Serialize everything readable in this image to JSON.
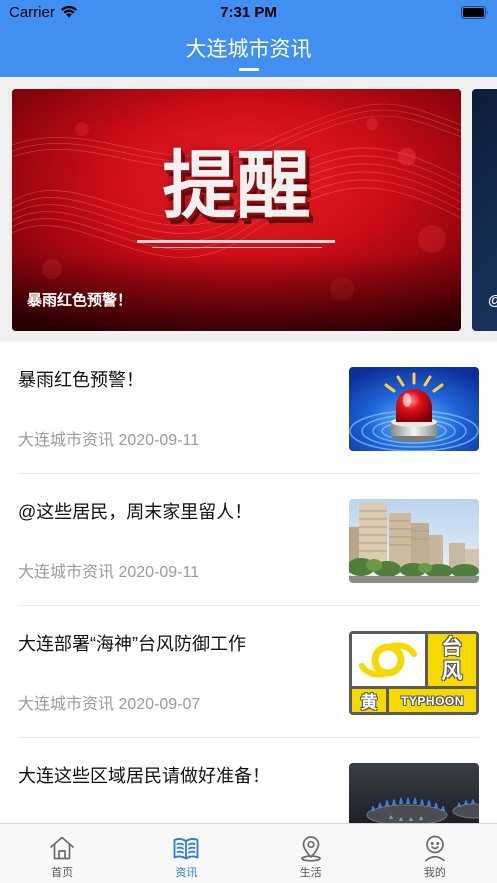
{
  "status_bar": {
    "carrier": "Carrier",
    "time": "7:31 PM",
    "icons": [
      "wifi-icon",
      "battery-icon"
    ]
  },
  "header": {
    "title": "大连城市资讯"
  },
  "banner": {
    "slides": [
      {
        "image": "red-alert-banner",
        "image_text": "提醒",
        "caption": "暴雨红色预警！"
      },
      {
        "image": "dark-blue-banner",
        "caption": "@"
      }
    ]
  },
  "news": [
    {
      "title": "暴雨红色预警！",
      "source": "大连城市资讯",
      "date": "2020-09-11",
      "thumbnail": "red-siren"
    },
    {
      "title": "@这些居民，周末家里留人！",
      "source": "大连城市资讯",
      "date": "2020-09-11",
      "thumbnail": "city-buildings"
    },
    {
      "title": "大连部署“海神”台风防御工作",
      "source": "大连城市资讯",
      "date": "2020-09-07",
      "thumbnail": "typhoon-yellow-warning-sign",
      "thumbnail_text": {
        "title": "台风",
        "level": "黄",
        "label": "TYPHOON"
      }
    },
    {
      "title": "大连这些区域居民请做好准备！",
      "thumbnail": "gas-stove-flames"
    }
  ],
  "tab_bar": {
    "tabs": [
      {
        "label": "首页",
        "icon": "home-icon",
        "active": false
      },
      {
        "label": "资讯",
        "icon": "book-icon",
        "active": true
      },
      {
        "label": "生活",
        "icon": "location-pin-icon",
        "active": false
      },
      {
        "label": "我的",
        "icon": "profile-icon",
        "active": false
      }
    ]
  },
  "colors": {
    "header_background": "#4190f1",
    "active_tab": "#2b7be0",
    "inactive_tab": "#666666",
    "meta_text": "#9b9b9b"
  }
}
